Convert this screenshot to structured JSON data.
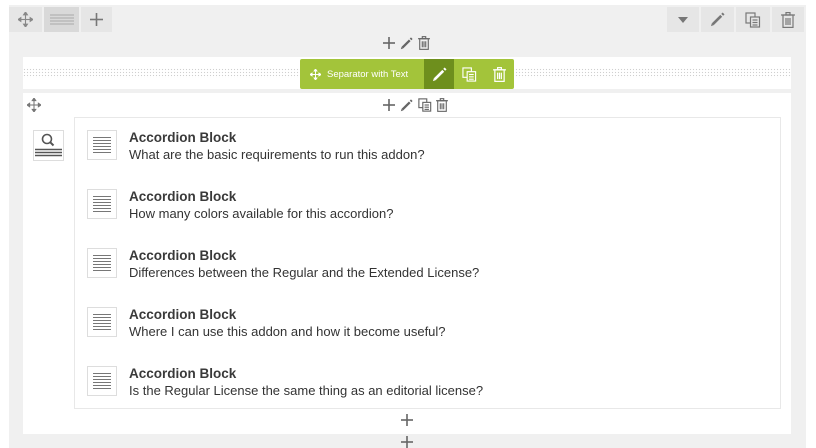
{
  "separator": {
    "label": "Separator with Text"
  },
  "accordion": {
    "items": [
      {
        "title": "Accordion Block",
        "text": "What are the basic requirements to run this addon?"
      },
      {
        "title": "Accordion Block",
        "text": "How many colors available for this accordion?"
      },
      {
        "title": "Accordion Block",
        "text": "Differences between the Regular and the Extended License?"
      },
      {
        "title": "Accordion Block",
        "text": "Where I can use this addon and how it become useful?"
      },
      {
        "title": "Accordion Block",
        "text": "Is the Regular License the same thing as an editorial license?"
      }
    ]
  },
  "colors": {
    "accent": "#a3c43a",
    "accent_dark": "#6e8f1d",
    "panel": "#f0f0f0",
    "button": "#e6e6e6"
  },
  "icons": [
    "move-icon",
    "layout-icon",
    "plus-icon",
    "chevron-down-icon",
    "pencil-icon",
    "copy-icon",
    "trash-icon",
    "search-icon"
  ]
}
